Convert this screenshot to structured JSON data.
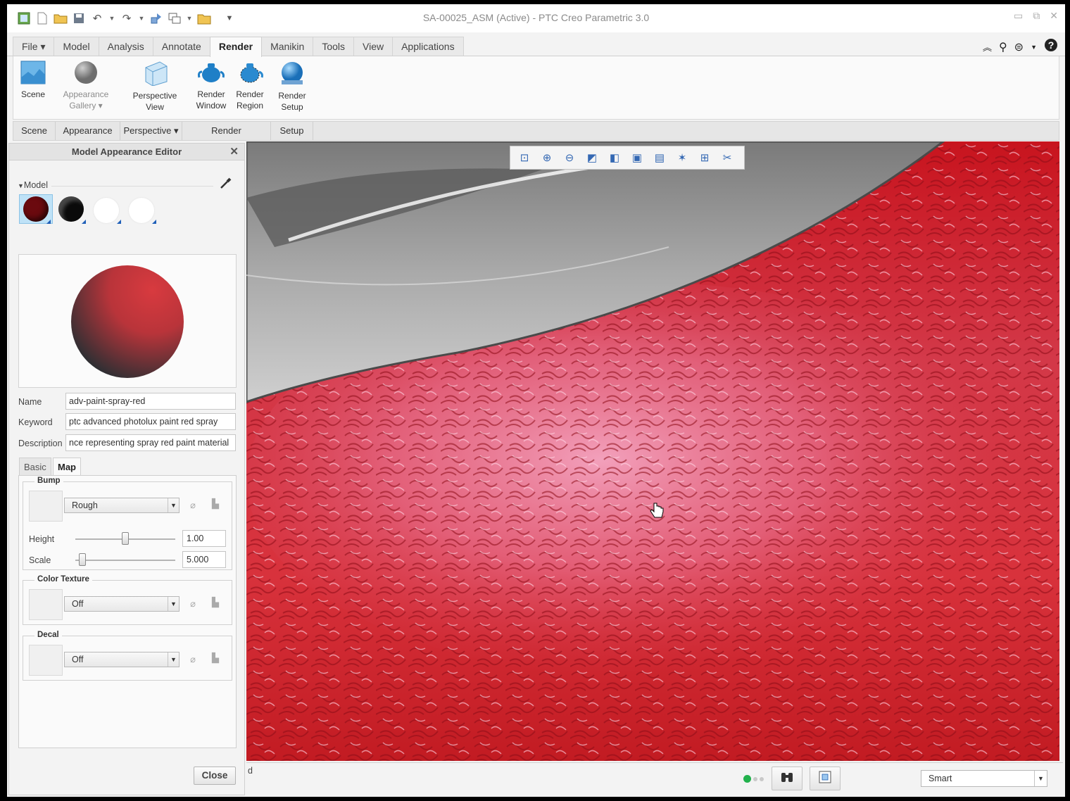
{
  "window": {
    "title": "SA-00025_ASM (Active) - PTC Creo Parametric 3.0"
  },
  "ribbon": {
    "tabs": [
      {
        "label": "File ▾"
      },
      {
        "label": "Model"
      },
      {
        "label": "Analysis"
      },
      {
        "label": "Annotate"
      },
      {
        "label": "Render"
      },
      {
        "label": "Manikin"
      },
      {
        "label": "Tools"
      },
      {
        "label": "View"
      },
      {
        "label": "Applications"
      }
    ],
    "active_tab": "Render",
    "buttons": {
      "scene": "Scene",
      "appearance_gallery_1": "Appearance",
      "appearance_gallery_2": "Gallery ▾",
      "perspective_view_1": "Perspective",
      "perspective_view_2": "View",
      "render_window_1": "Render",
      "render_window_2": "Window",
      "render_region_1": "Render",
      "render_region_2": "Region",
      "render_setup_1": "Render",
      "render_setup_2": "Setup"
    },
    "groups": {
      "scene": "Scene",
      "appearance": "Appearance",
      "perspective": "Perspective ▾",
      "render": "Render",
      "setup": "Setup"
    }
  },
  "editor": {
    "title": "Model Appearance Editor",
    "model_label": "Model",
    "swatches": [
      {
        "name": "dark-red",
        "color": "#6b0a0f"
      },
      {
        "name": "black",
        "color": "#0a0a0a"
      },
      {
        "name": "white-1",
        "color": "#ffffff"
      },
      {
        "name": "white-2",
        "color": "#ffffff"
      }
    ],
    "preview_color": "#d83a3f",
    "name_label": "Name",
    "name_value": "adv-paint-spray-red",
    "keyword_label": "Keyword",
    "keyword_value": "ptc advanced photolux paint red spray",
    "description_label": "Description",
    "description_value": "nce representing spray red paint material",
    "tabs": {
      "basic": "Basic",
      "map": "Map"
    },
    "bump": {
      "legend": "Bump",
      "value": "Rough",
      "height_label": "Height",
      "height_value": "1.00",
      "height_level": 0.5,
      "scale_label": "Scale",
      "scale_value": "5.000",
      "scale_level": 0.07
    },
    "color_texture": {
      "legend": "Color Texture",
      "value": "Off"
    },
    "decal": {
      "legend": "Decal",
      "value": "Off"
    },
    "close_label": "Close"
  },
  "status": {
    "message": "d",
    "filter_value": "Smart"
  }
}
